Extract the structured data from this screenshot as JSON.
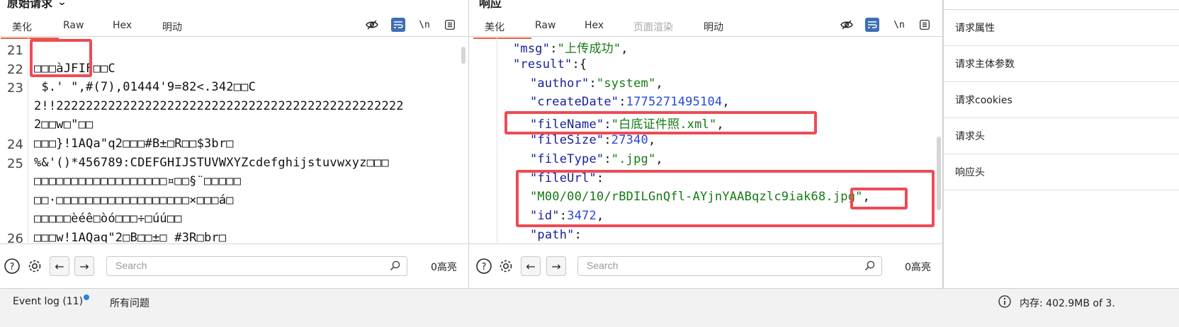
{
  "request": {
    "title": "原始请求",
    "tabs": [
      "美化",
      "Raw",
      "Hex",
      "明动"
    ],
    "lines": [
      {
        "n": "21",
        "t": ""
      },
      {
        "n": "22",
        "t": "□□□àJFIF□□C"
      },
      {
        "n": "23",
        "t": " $.' \",#(7),01444'9=82<.342□□C"
      },
      {
        "n": "",
        "t": "2!!22222222222222222222222222222222222222222222222"
      },
      {
        "n": "",
        "t": "2□□w□\"□□"
      },
      {
        "n": "24",
        "t": "□□□}!1AQa\"q2□□□#B±□R□□$3br□"
      },
      {
        "n": "25",
        "t": "%&'()*456789:CDEFGHIJSTUVWXYZcdefghijstuvwxyz□□□"
      },
      {
        "n": "",
        "t": "□□□□□□□□□□□□□□□□□□¤□□§¨□□□□□"
      },
      {
        "n": "",
        "t": "□□·□□□□□□□□□□□□□□□□□□×□□□á□"
      },
      {
        "n": "",
        "t": "□□□□□èéê□òó□□□÷□úú□□"
      },
      {
        "n": "26",
        "t": "□□□w!1AQaq\"2□B□□±□ #3R□br□"
      }
    ],
    "search_placeholder": "Search",
    "highlight_count": "0高亮"
  },
  "response": {
    "title": "响应",
    "tabs": [
      "美化",
      "Raw",
      "Hex",
      "页面渲染",
      "明动"
    ],
    "lines": [
      {
        "i": 1,
        "p": [
          [
            "k",
            "\"msg\""
          ],
          [
            "p",
            ":"
          ],
          [
            "s",
            "\"上传成功\""
          ],
          [
            "p",
            ","
          ]
        ]
      },
      {
        "i": 1,
        "p": [
          [
            "k",
            "\"result\""
          ],
          [
            "p",
            ":{"
          ]
        ]
      },
      {
        "i": 2,
        "p": [
          [
            "k",
            "\"author\""
          ],
          [
            "p",
            ":"
          ],
          [
            "s",
            "\"system\""
          ],
          [
            "p",
            ","
          ]
        ]
      },
      {
        "i": 2,
        "p": [
          [
            "k",
            "\"createDate\""
          ],
          [
            "p",
            ":"
          ],
          [
            "n",
            "1775271495104"
          ],
          [
            "p",
            ","
          ]
        ]
      },
      {
        "i": 2,
        "p": [
          [
            "k",
            "\"fileName\""
          ],
          [
            "p",
            ":"
          ],
          [
            "s",
            "\"白底证件照.xml\""
          ],
          [
            "p",
            ","
          ]
        ]
      },
      {
        "i": 2,
        "p": [
          [
            "k",
            "\"fileSize\""
          ],
          [
            "p",
            ":"
          ],
          [
            "n",
            "27340"
          ],
          [
            "p",
            ","
          ]
        ]
      },
      {
        "i": 2,
        "p": [
          [
            "k",
            "\"fileType\""
          ],
          [
            "p",
            ":"
          ],
          [
            "s",
            "\".jpg\""
          ],
          [
            "p",
            ","
          ]
        ]
      },
      {
        "i": 2,
        "p": [
          [
            "k",
            "\"fileUrl\""
          ],
          [
            "p",
            ":"
          ]
        ]
      },
      {
        "i": 2,
        "p": [
          [
            "s",
            "\"M00/00/10/rBDILGnQfl-AYjnYAABqzlc9iak68.jpg\""
          ],
          [
            "p",
            ","
          ]
        ]
      },
      {
        "i": 2,
        "p": [
          [
            "k",
            "\"id\""
          ],
          [
            "p",
            ":"
          ],
          [
            "n",
            "3472"
          ],
          [
            "p",
            ","
          ]
        ]
      },
      {
        "i": 2,
        "p": [
          [
            "k",
            "\"path\""
          ],
          [
            "p",
            ":"
          ]
        ]
      }
    ],
    "search_placeholder": "Search",
    "highlight_count": "0高亮"
  },
  "side_panel": {
    "items": [
      "请求属性",
      "请求主体参数",
      "请求cookies",
      "请求头",
      "响应头"
    ]
  },
  "status_bar": {
    "event_log": "Event log (11)",
    "all_issues": "所有问题",
    "memory": "内存: 402.9MB of 3."
  },
  "colors": {
    "accent_tab_underline": "#e8613c",
    "highlight_box": "#ee4b56",
    "json_key": "#1a2196",
    "json_string": "#147a14",
    "json_number": "#2848d8",
    "wrap_toggle_active": "#3d6fb6",
    "notification_dot": "#1e88e5"
  }
}
